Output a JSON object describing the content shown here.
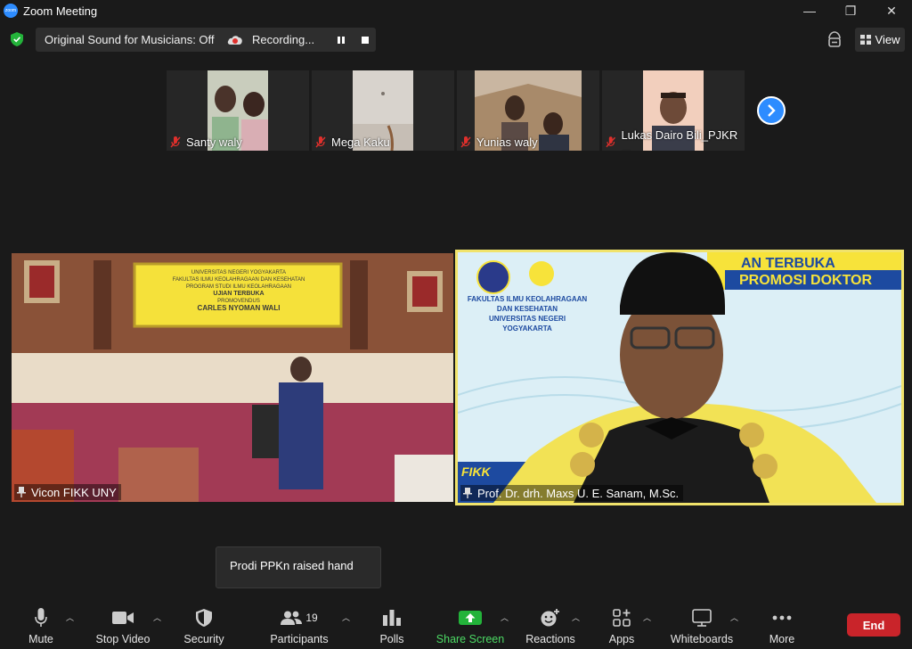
{
  "window": {
    "title": "Zoom Meeting",
    "logo_text": "zoom",
    "controls": [
      "—",
      "❐",
      "✕"
    ]
  },
  "status": {
    "original_sound": "Original Sound for Musicians: Off",
    "recording": "Recording...",
    "view_label": "View"
  },
  "thumbnails": [
    {
      "name": "Santy waly"
    },
    {
      "name": "Mega Kaku"
    },
    {
      "name": "Yunias waly"
    },
    {
      "name": "Lukas Dairo Bili_PJKR ..."
    }
  ],
  "videos": {
    "left": {
      "label": "Vicon FIKK UNY",
      "banner_top": "UNIVERSITAS NEGERI YOGYAKARTA",
      "banner_sub1": "FAKULTAS ILMU KEOLAHRAGAAN DAN KESEHATAN",
      "banner_sub2": "PROGRAM STUDI ILMU KEOLAHRAGAAN",
      "banner_event": "UJIAN TERBUKA",
      "banner_promo": "PROMOVENDUS",
      "banner_name": "CARLES NYOMAN WALI"
    },
    "right": {
      "label": "Prof. Dr. drh. Maxs U. E. Sanam, M.Sc.",
      "banner_line1": "AN TERBUKA",
      "banner_line2": "PROMOSI DOKTOR",
      "faculty_line1": "FAKULTAS ILMU KEOLAHRAGAAN",
      "faculty_line2": "DAN KESEHATAN",
      "faculty_line3": "UNIVERSITAS NEGERI YOGYAKARTA",
      "fikk_text": "FIKK"
    }
  },
  "toast": {
    "text": "Prodi PPKn raised hand"
  },
  "toolbar": {
    "mute": "Mute",
    "stop_video": "Stop Video",
    "security": "Security",
    "participants": "Participants",
    "participants_count": "19",
    "polls": "Polls",
    "share_screen": "Share Screen",
    "reactions": "Reactions",
    "apps": "Apps",
    "whiteboards": "Whiteboards",
    "more": "More",
    "end": "End"
  },
  "colors": {
    "accent": "#2d8cff",
    "share_green": "#23b33a",
    "end_red": "#c9242a",
    "active_speaker_border": "#f1e36b",
    "mic_off_red": "#e0302c"
  }
}
